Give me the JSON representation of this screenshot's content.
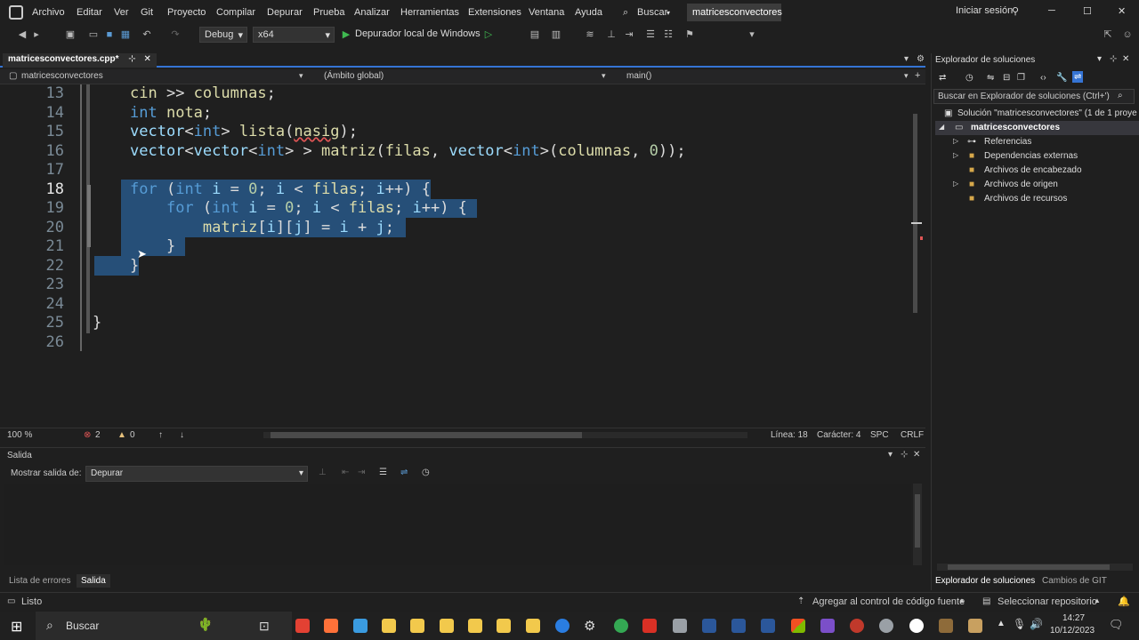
{
  "menu": [
    "Archivo",
    "Editar",
    "Ver",
    "Git",
    "Proyecto",
    "Compilar",
    "Depurar",
    "Prueba",
    "Analizar",
    "Herramientas",
    "Extensiones",
    "Ventana",
    "Ayuda"
  ],
  "search_label": "Buscar",
  "solution_name": "matricesconvectores",
  "signin": "Iniciar sesión",
  "toolbar": {
    "config": "Debug",
    "platform": "x64",
    "debugger": "Depurador local de Windows"
  },
  "editor": {
    "tab": "matricesconvectores.cpp*",
    "nav_project": "matricesconvectores",
    "nav_scope": "(Ámbito global)",
    "nav_function": "main()"
  },
  "code_lines": [
    {
      "n": "13",
      "t": "cin >> columnas;"
    },
    {
      "n": "14",
      "t": "int nota;"
    },
    {
      "n": "15",
      "t": "vector<int> lista(nasig);"
    },
    {
      "n": "16",
      "t": "vector<vector<int> > matriz(filas, vector<int>(columnas, 0));"
    },
    {
      "n": "17",
      "t": ""
    },
    {
      "n": "18",
      "t": "for (int i = 0; i < filas; i++) {"
    },
    {
      "n": "19",
      "t": "    for (int i = 0; i < filas; i++) {"
    },
    {
      "n": "20",
      "t": "        matriz[i][j] = i + j;"
    },
    {
      "n": "21",
      "t": "    }"
    },
    {
      "n": "22",
      "t": "}"
    },
    {
      "n": "23",
      "t": ""
    },
    {
      "n": "24",
      "t": ""
    },
    {
      "n": "25",
      "t": "}"
    },
    {
      "n": "26",
      "t": ""
    }
  ],
  "status_line": {
    "zoom": "100 %",
    "errors": "2",
    "warnings": "0",
    "line": "Línea: 18",
    "char": "Carácter: 4",
    "spc": "SPC",
    "crlf": "CRLF"
  },
  "output": {
    "title": "Salida",
    "show_label": "Mostrar salida de:",
    "source": "Depurar"
  },
  "bottom_tabs": [
    "Lista de errores",
    "Salida"
  ],
  "solution_explorer": {
    "title": "Explorador de soluciones",
    "search": "Buscar en Explorador de soluciones (Ctrl+')",
    "solution": "Solución \"matricesconvectores\" (1 de 1 proye",
    "project": "matricesconvectores",
    "items": [
      "Referencias",
      "Dependencias externas",
      "Archivos de encabezado",
      "Archivos de origen",
      "Archivos de recursos"
    ],
    "tabs": [
      "Explorador de soluciones",
      "Cambios de GIT"
    ]
  },
  "statusbar": {
    "ready": "Listo",
    "git_add": "Agregar al control de código fuente",
    "repo": "Seleccionar repositorio"
  },
  "taskbar": {
    "search": "Buscar",
    "time": "14:27",
    "date": "10/12/2023"
  }
}
